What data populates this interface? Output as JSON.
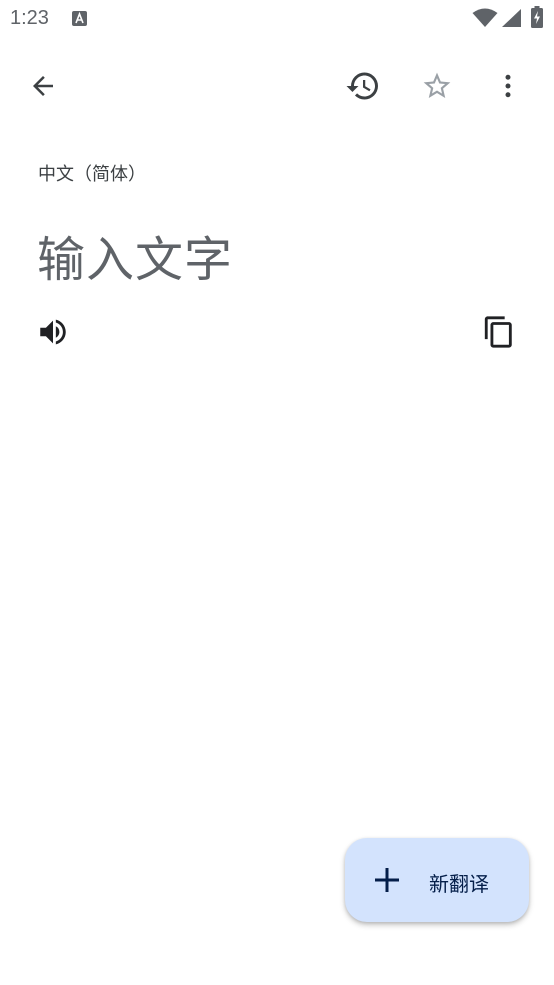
{
  "status_bar": {
    "time": "1:23",
    "app_icon": "a-notification-icon",
    "wifi_icon": "wifi-icon",
    "signal_icon": "cell-signal-icon",
    "battery_icon": "battery-charging-icon"
  },
  "toolbar": {
    "back_icon": "arrow-back-icon",
    "history_icon": "history-icon",
    "star_icon": "star-outline-icon",
    "more_icon": "more-vert-icon"
  },
  "content": {
    "source_language": "中文（简体）",
    "input_placeholder": "输入文字",
    "speaker_icon": "volume-icon",
    "copy_icon": "copy-icon"
  },
  "fab": {
    "label": "新翻译",
    "icon": "plus-icon"
  },
  "colors": {
    "icon": "#3c4043",
    "fab_background": "#d3e3fd",
    "fab_text": "#041e49",
    "star_outline": "#9aa0a6"
  }
}
